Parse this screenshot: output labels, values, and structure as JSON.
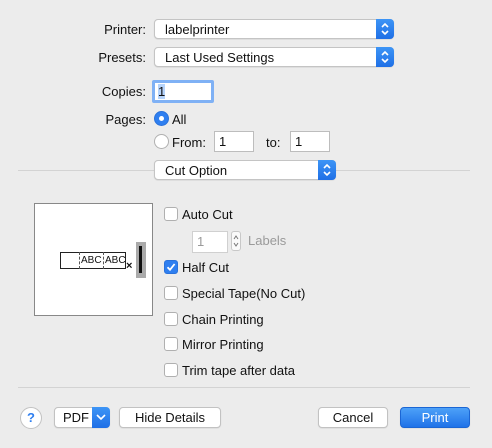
{
  "printer": {
    "label": "Printer:",
    "value": "labelprinter"
  },
  "presets": {
    "label": "Presets:",
    "value": "Last Used Settings"
  },
  "copies": {
    "label": "Copies:",
    "value": "1"
  },
  "pages": {
    "label": "Pages:",
    "all_label": "All",
    "from_label": "From:",
    "from_value": "1",
    "to_label": "to:",
    "to_value": "1"
  },
  "section": {
    "value": "Cut Option"
  },
  "preview": {
    "tape_text_1": "ABC",
    "tape_text_2": "ABC",
    "mark": "×"
  },
  "options": {
    "auto_cut": "Auto Cut",
    "labels_value": "1",
    "labels_label": "Labels",
    "half_cut": "Half Cut",
    "special_tape": "Special Tape(No Cut)",
    "chain_printing": "Chain Printing",
    "mirror_printing": "Mirror Printing",
    "trim_tape": "Trim tape after data"
  },
  "footer": {
    "help": "?",
    "pdf": "PDF",
    "hide_details": "Hide Details",
    "cancel": "Cancel",
    "print": "Print"
  }
}
